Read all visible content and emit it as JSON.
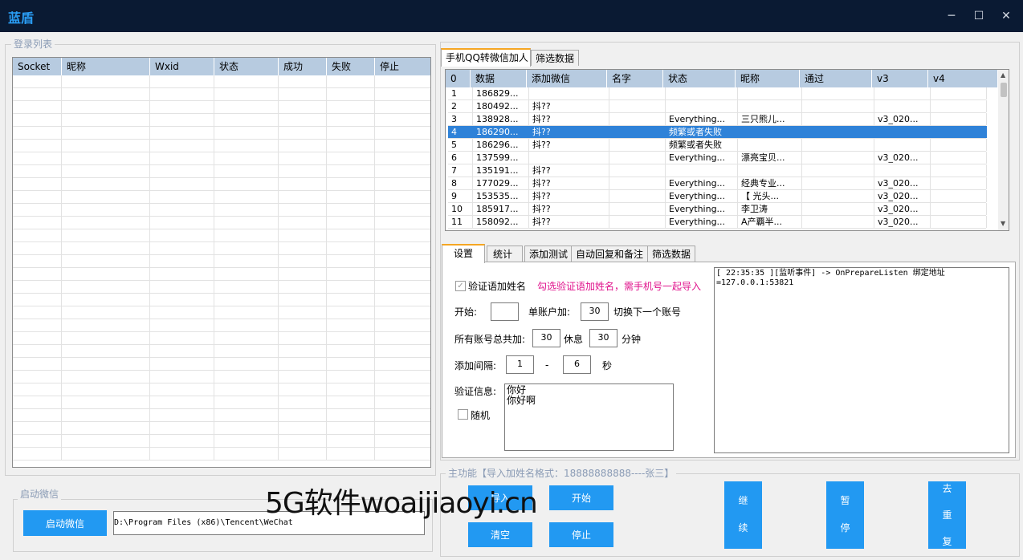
{
  "app": {
    "title": "蓝盾",
    "minimize": "─",
    "maximize": "☐",
    "close": "✕"
  },
  "login": {
    "title": "登录列表",
    "columns": [
      "Socket",
      "昵称",
      "Wxid",
      "状态",
      "成功",
      "失败",
      "停止"
    ]
  },
  "startwx": {
    "title": "启动微信",
    "button": "启动微信",
    "path": "D:\\Program Files (x86)\\Tencent\\WeChat"
  },
  "toptabs": [
    "手机QQ转微信加人",
    "筛选数据"
  ],
  "datagrid": {
    "columns": [
      "0",
      "数据",
      "添加微信",
      "名字",
      "状态",
      "昵称",
      "通过",
      "v3",
      "v4"
    ],
    "rows": [
      [
        "1",
        "186829...",
        "",
        "",
        "",
        "",
        "",
        "",
        ""
      ],
      [
        "2",
        "180492...",
        "抖??",
        "",
        "",
        "",
        "",
        "",
        ""
      ],
      [
        "3",
        "138928...",
        "抖??",
        "",
        "Everything...",
        "三只熊儿...",
        "",
        "v3_020...",
        ""
      ],
      [
        "4",
        "186290...",
        "抖??",
        "",
        "频繁或者失败",
        "",
        "",
        "",
        ""
      ],
      [
        "5",
        "186296...",
        "抖??",
        "",
        "频繁或者失败",
        "",
        "",
        "",
        ""
      ],
      [
        "6",
        "137599...",
        "",
        "",
        "Everything...",
        "漂亮宝贝...",
        "",
        "v3_020...",
        ""
      ],
      [
        "7",
        "135191...",
        "抖??",
        "",
        "",
        "",
        "",
        "",
        ""
      ],
      [
        "8",
        "177029...",
        "抖??",
        "",
        "Everything...",
        "经典专业...",
        "",
        "v3_020...",
        ""
      ],
      [
        "9",
        "153535...",
        "抖??",
        "",
        "Everything...",
        "【 光头...",
        "",
        "v3_020...",
        ""
      ],
      [
        "10",
        "185917...",
        "抖??",
        "",
        "Everything...",
        "李卫涛",
        "",
        "v3_020...",
        ""
      ],
      [
        "11",
        "158092...",
        "抖??",
        "",
        "Everything...",
        "A产覇半...",
        "",
        "v3_020...",
        ""
      ]
    ]
  },
  "tabs2": [
    "设置",
    "统计",
    "添加测试",
    "自动回复和备注",
    "筛选数据"
  ],
  "settings": {
    "verify_name_label": "验证语加姓名",
    "verify_name_hint": "勾选验证语加姓名，需手机号一起导入",
    "start_label": "开始:",
    "start_value": "",
    "per_account_label": "单账户加:",
    "per_account_value": "30",
    "switch_label": "切换下一个账号",
    "total_label": "所有账号总共加:",
    "total_value": "30",
    "rest_label": "休息",
    "rest_value": "30",
    "minutes_label": "分钟",
    "interval_label": "添加间隔:",
    "interval_min": "1",
    "interval_dash": "-",
    "interval_max": "6",
    "seconds_label": "秒",
    "verify_info_label": "验证信息:",
    "random_label": "随机",
    "verify_line1": "你好",
    "verify_line2": "你好啊"
  },
  "log": {
    "line1": "[ 22:35:35 ][监听事件] -> OnPrepareListen 绑定地址",
    "line2": "=127.0.0.1:53821"
  },
  "main": {
    "title": "主功能【导入加姓名格式：18888888888----张三】",
    "import_btn": "导入",
    "start_btn": "开始",
    "clear_btn": "清空",
    "stop_btn": "停止",
    "continue_chars": [
      "继",
      "续"
    ],
    "pause_chars": [
      "暂",
      "停"
    ],
    "dedup_chars": [
      "去",
      "重",
      "复"
    ]
  },
  "watermark": "5G软件woaijiaoyi.cn"
}
